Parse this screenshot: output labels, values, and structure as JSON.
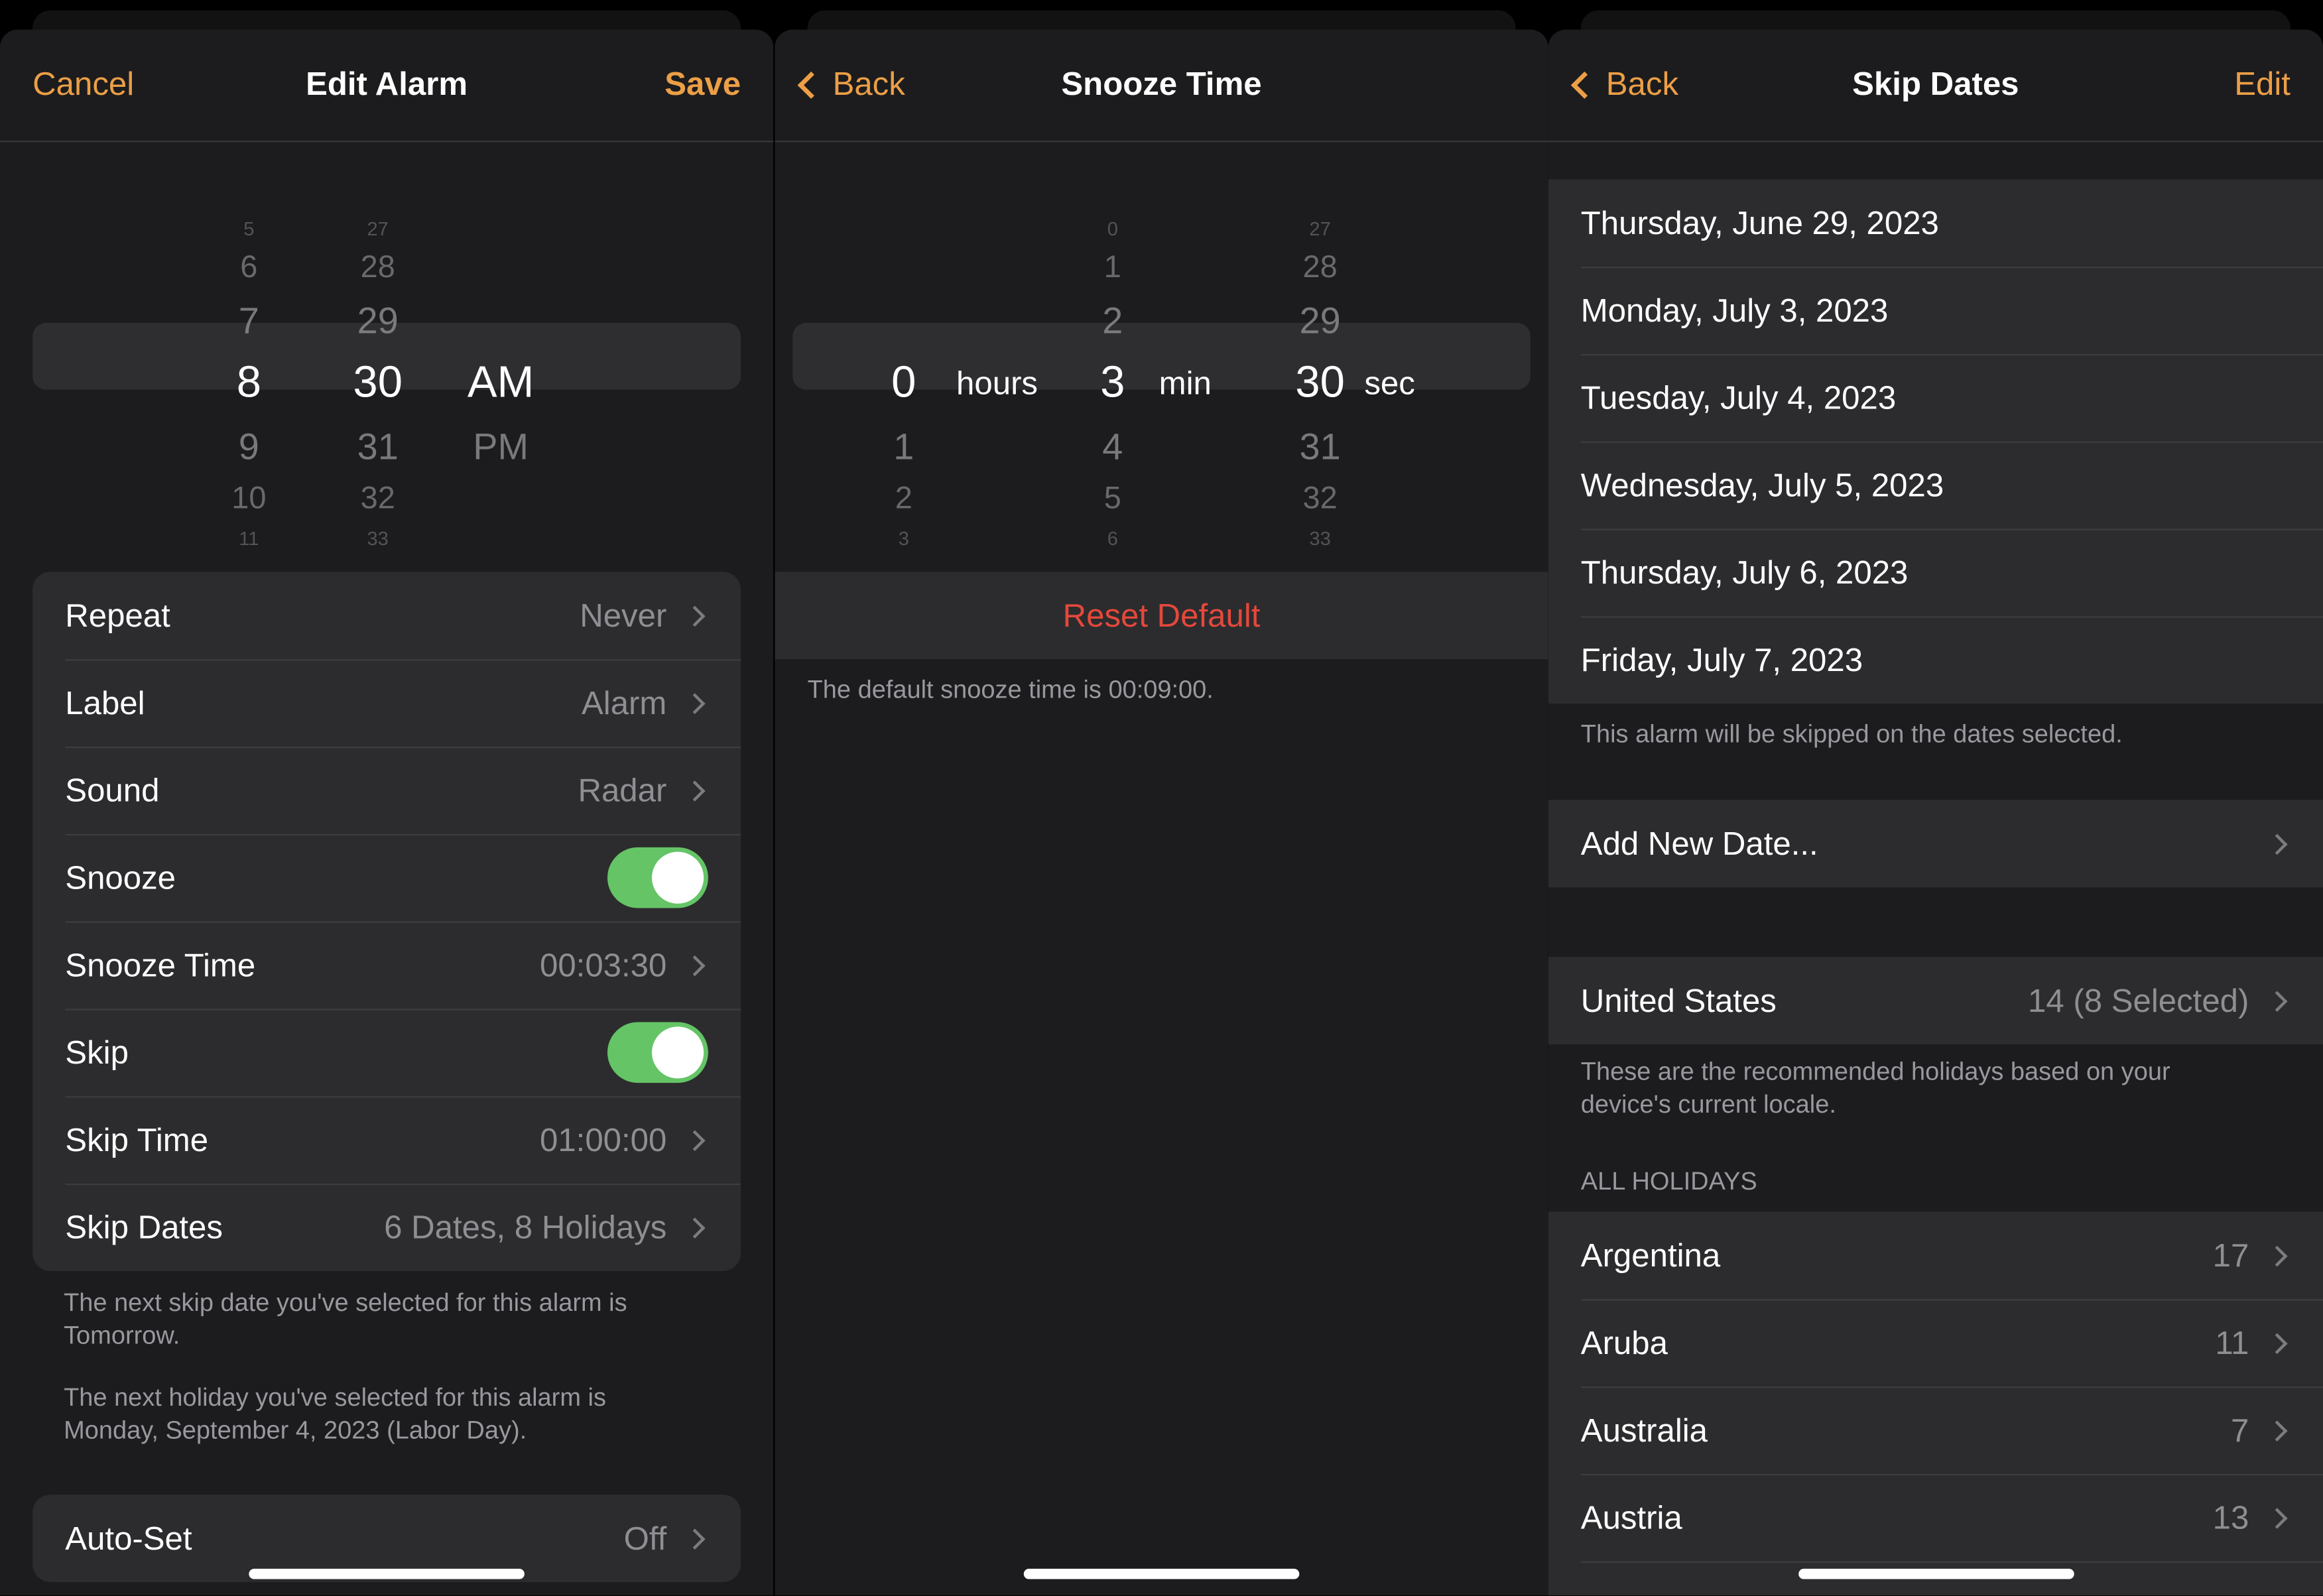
{
  "colors": {
    "accent": "#ec9f46",
    "toggle_on": "#65c466",
    "destructive": "#e5483b"
  },
  "edit_alarm": {
    "cancel": "Cancel",
    "title": "Edit Alarm",
    "save": "Save",
    "picker": {
      "hours": [
        "5",
        "6",
        "7",
        "8",
        "9",
        "10",
        "11"
      ],
      "minutes": [
        "27",
        "28",
        "29",
        "30",
        "31",
        "32",
        "33"
      ],
      "period": [
        "AM",
        "PM"
      ],
      "selected": "8:30 AM"
    },
    "rows": [
      {
        "label": "Repeat",
        "value": "Never",
        "type": "link"
      },
      {
        "label": "Label",
        "value": "Alarm",
        "type": "link"
      },
      {
        "label": "Sound",
        "value": "Radar",
        "type": "link"
      },
      {
        "label": "Snooze",
        "value": "",
        "type": "toggle",
        "on": true
      },
      {
        "label": "Snooze Time",
        "value": "00:03:30",
        "type": "link"
      },
      {
        "label": "Skip",
        "value": "",
        "type": "toggle",
        "on": true
      },
      {
        "label": "Skip Time",
        "value": "01:00:00",
        "type": "link"
      },
      {
        "label": "Skip Dates",
        "value": "6 Dates, 8 Holidays",
        "type": "link"
      }
    ],
    "note1": "The next skip date you've selected for this alarm is Tomorrow.",
    "note2": "The next holiday you've selected for this alarm is Monday, September 4, 2023 (Labor Day).",
    "auto_set": {
      "label": "Auto-Set",
      "value": "Off"
    }
  },
  "snooze_time": {
    "back": "Back",
    "title": "Snooze Time",
    "picker": {
      "hours": [
        "0",
        "1",
        "2",
        "3"
      ],
      "minutes": [
        "0",
        "1",
        "2",
        "3",
        "4",
        "5",
        "6"
      ],
      "seconds": [
        "27",
        "28",
        "29",
        "30",
        "31",
        "32",
        "33"
      ],
      "hours_unit": "hours",
      "min_unit": "min",
      "sec_unit": "sec"
    },
    "reset": "Reset Default",
    "note": "The default snooze time is 00:09:00."
  },
  "skip_dates": {
    "back": "Back",
    "title": "Skip Dates",
    "edit": "Edit",
    "dates": [
      "Thursday, June 29, 2023",
      "Monday, July 3, 2023",
      "Tuesday, July 4, 2023",
      "Wednesday, July 5, 2023",
      "Thursday, July 6, 2023",
      "Friday, July 7, 2023"
    ],
    "dates_note": "This alarm will be skipped on the dates selected.",
    "add_new": "Add New Date...",
    "locale": {
      "label": "United States",
      "value": "14 (8 Selected)"
    },
    "locale_note": "These are the recommended holidays based on your device's current locale.",
    "section": "ALL HOLIDAYS",
    "countries": [
      {
        "label": "Argentina",
        "value": "17"
      },
      {
        "label": "Aruba",
        "value": "11"
      },
      {
        "label": "Australia",
        "value": "7"
      },
      {
        "label": "Austria",
        "value": "13"
      }
    ]
  }
}
